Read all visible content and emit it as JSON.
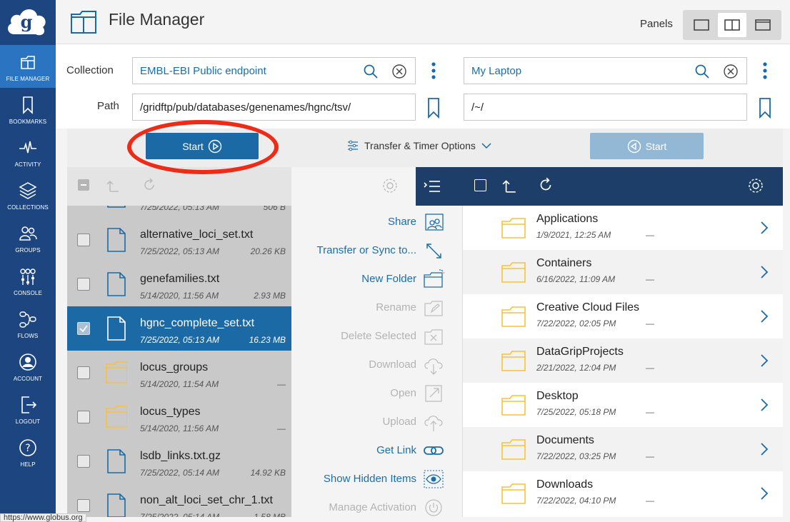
{
  "header": {
    "title": "File Manager",
    "panels_label": "Panels"
  },
  "sidebar": {
    "items": [
      {
        "label": "File Manager",
        "icon": "file-manager-icon",
        "active": true
      },
      {
        "label": "Bookmarks",
        "icon": "bookmark-icon"
      },
      {
        "label": "Activity",
        "icon": "activity-icon"
      },
      {
        "label": "Collections",
        "icon": "collections-icon"
      },
      {
        "label": "Groups",
        "icon": "groups-icon"
      },
      {
        "label": "Console",
        "icon": "console-icon"
      },
      {
        "label": "Flows",
        "icon": "flows-icon"
      },
      {
        "label": "Account",
        "icon": "account-icon"
      },
      {
        "label": "Logout",
        "icon": "logout-icon"
      },
      {
        "label": "Help",
        "icon": "help-icon"
      }
    ]
  },
  "form": {
    "collection_label": "Collection",
    "path_label": "Path",
    "left_collection": "EMBL-EBI Public endpoint",
    "left_path": "/gridftp/pub/databases/genenames/hgnc/tsv/",
    "right_collection": "My Laptop",
    "right_path": "/~/"
  },
  "transfer": {
    "start_label": "Start",
    "options_label": "Transfer & Timer Options",
    "start_right_label": "Start"
  },
  "left_files": [
    {
      "name": "",
      "date": "7/25/2022, 05:13 AM",
      "size": "506 B",
      "type": "file"
    },
    {
      "name": "alternative_loci_set.txt",
      "date": "7/25/2022, 05:13 AM",
      "size": "20.26 KB",
      "type": "file"
    },
    {
      "name": "genefamilies.txt",
      "date": "5/14/2020, 11:56 AM",
      "size": "2.93 MB",
      "type": "file"
    },
    {
      "name": "hgnc_complete_set.txt",
      "date": "7/25/2022, 05:13 AM",
      "size": "16.23 MB",
      "type": "file",
      "selected": true
    },
    {
      "name": "locus_groups",
      "date": "5/14/2020, 11:54 AM",
      "size": "—",
      "type": "folder"
    },
    {
      "name": "locus_types",
      "date": "5/14/2020, 11:56 AM",
      "size": "—",
      "type": "folder"
    },
    {
      "name": "lsdb_links.txt.gz",
      "date": "7/25/2022, 05:14 AM",
      "size": "14.92 KB",
      "type": "file"
    },
    {
      "name": "non_alt_loci_set_chr_1.txt",
      "date": "7/25/2022, 05:14 AM",
      "size": "1.58 MB",
      "type": "file"
    }
  ],
  "actions": [
    {
      "label": "Share",
      "enabled": true,
      "icon": "share-icon"
    },
    {
      "label": "Transfer or Sync to...",
      "enabled": true,
      "icon": "transfer-icon"
    },
    {
      "label": "New Folder",
      "enabled": true,
      "icon": "new-folder-icon"
    },
    {
      "label": "Rename",
      "enabled": false,
      "icon": "rename-icon"
    },
    {
      "label": "Delete Selected",
      "enabled": false,
      "icon": "delete-icon"
    },
    {
      "label": "Download",
      "enabled": false,
      "icon": "download-icon"
    },
    {
      "label": "Open",
      "enabled": false,
      "icon": "open-icon"
    },
    {
      "label": "Upload",
      "enabled": false,
      "icon": "upload-icon"
    },
    {
      "label": "Get Link",
      "enabled": true,
      "icon": "link-icon"
    },
    {
      "label": "Show Hidden Items",
      "enabled": true,
      "icon": "eye-icon"
    },
    {
      "label": "Manage Activation",
      "enabled": false,
      "icon": "power-icon"
    }
  ],
  "right_files": [
    {
      "name": "Applications",
      "date": "1/9/2021, 12:25 AM",
      "size": "—"
    },
    {
      "name": "Containers",
      "date": "6/16/2022, 11:09 AM",
      "size": "—"
    },
    {
      "name": "Creative Cloud Files",
      "date": "7/22/2022, 02:05 PM",
      "size": "—"
    },
    {
      "name": "DataGripProjects",
      "date": "2/21/2022, 12:04 PM",
      "size": "—"
    },
    {
      "name": "Desktop",
      "date": "7/25/2022, 05:18 PM",
      "size": "—"
    },
    {
      "name": "Documents",
      "date": "7/22/2022, 03:25 PM",
      "size": "—"
    },
    {
      "name": "Downloads",
      "date": "7/22/2022, 04:10 PM",
      "size": "—"
    }
  ],
  "status_url": "https://www.globus.org",
  "colors": {
    "sidebar": "#1d4580",
    "sidebar_active": "#2b74c2",
    "primary": "#1b6aa5",
    "annotation": "#ee2b16",
    "folder": "#f7c23b"
  }
}
